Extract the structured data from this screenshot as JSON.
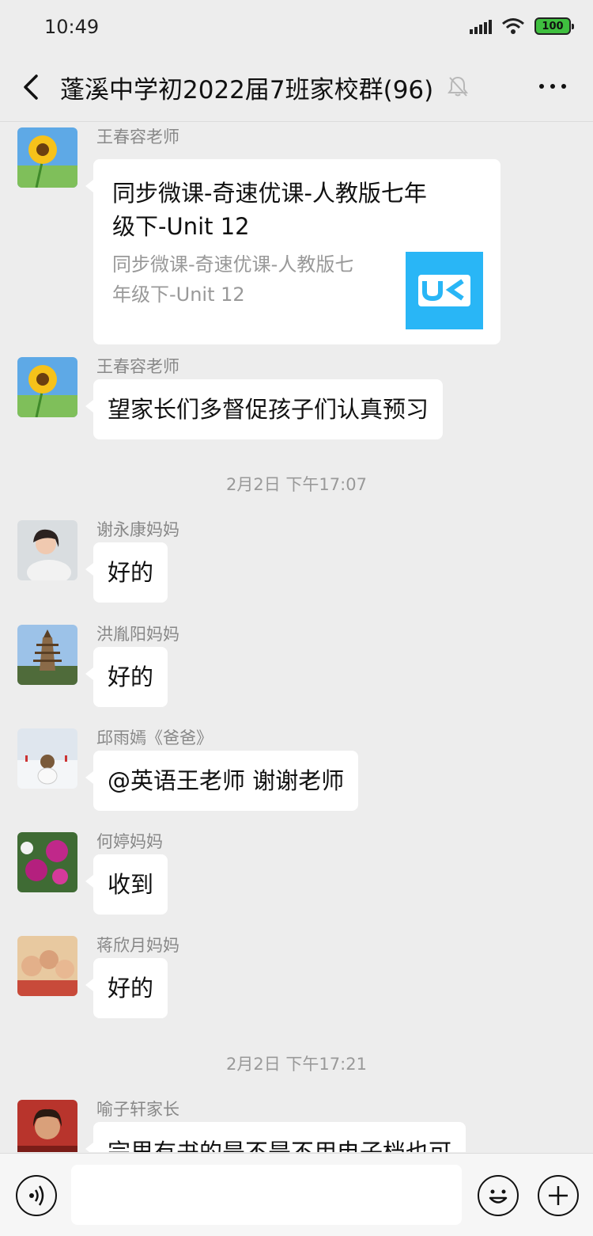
{
  "status_bar": {
    "time": "10:49",
    "battery": "100"
  },
  "header": {
    "title": "蓬溪中学初2022届7班家校群(96)"
  },
  "messages": [
    {
      "sender": "王春容老师",
      "type": "link-card",
      "card_title": "同步微课-奇速优课-人教版七年\n级下-Unit 12",
      "card_desc": "同步微课-奇速优课-人教版七\n年级下-Unit 12",
      "card_logo": "UK"
    },
    {
      "sender": "王春容老师",
      "text": "望家长们多督促孩子们认真预习"
    },
    {
      "sender": "谢永康妈妈",
      "text": "好的"
    },
    {
      "sender": "洪胤阳妈妈",
      "text": "好的"
    },
    {
      "sender": "邱雨嫣《爸爸》",
      "text": "@英语王老师  谢谢老师"
    },
    {
      "sender": "何婷妈妈",
      "text": "收到"
    },
    {
      "sender": "蒋欣月妈妈",
      "text": "好的"
    },
    {
      "sender": "喻子轩家长",
      "text": "宗里有书的是不是不用电子档也可"
    }
  ],
  "timestamps": [
    "2月2日 下午17:07",
    "2月2日 下午17:21"
  ],
  "colors": {
    "background": "#ededed",
    "bubble": "#ffffff",
    "card_logo": "#29b6f6",
    "battery": "#3fbf3f"
  },
  "icons": {
    "back": "chevron-left-icon",
    "mute": "bell-muted-icon",
    "more": "more-dots-icon",
    "voice": "voice-icon",
    "emoji": "emoji-icon",
    "plus": "plus-icon"
  }
}
